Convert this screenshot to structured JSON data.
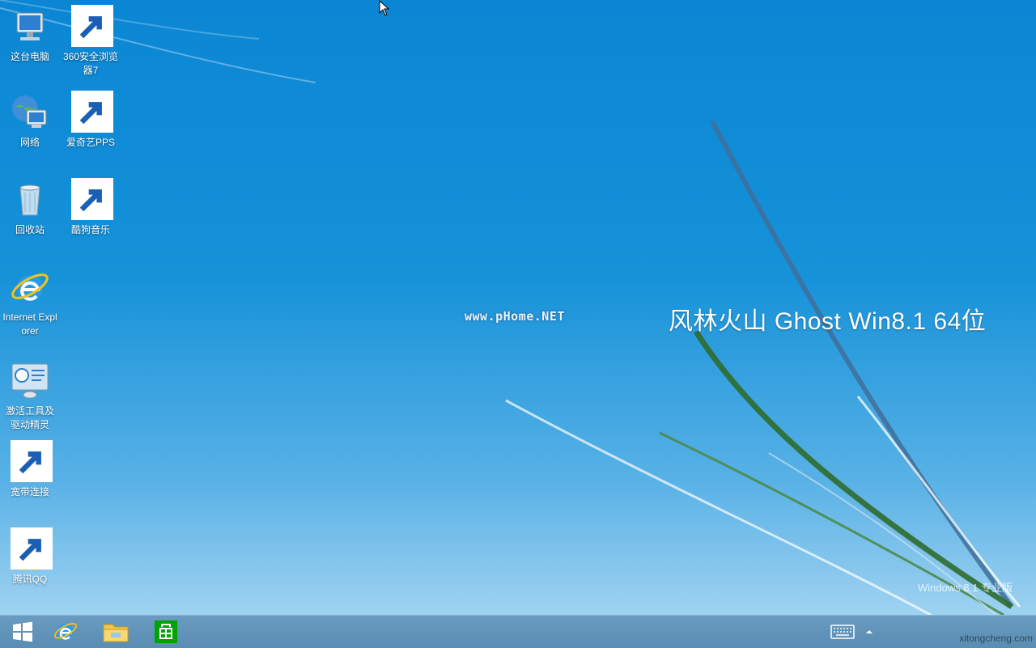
{
  "desktop": {
    "icons": [
      {
        "id": "this-pc",
        "label": "这台电脑"
      },
      {
        "id": "360-browser",
        "label": "360安全浏览器7"
      },
      {
        "id": "network",
        "label": "网络"
      },
      {
        "id": "iqiyi",
        "label": "爱奇艺PPS"
      },
      {
        "id": "recycle-bin",
        "label": "回收站"
      },
      {
        "id": "kugou",
        "label": "酷狗音乐"
      },
      {
        "id": "internet-explorer",
        "label": "Internet Explorer"
      },
      {
        "id": "activation-tools",
        "label": "激活工具及驱动精灵"
      },
      {
        "id": "broadband",
        "label": "宽带连接"
      },
      {
        "id": "tencent-qq",
        "label": "腾讯QQ"
      }
    ]
  },
  "wallpaper": {
    "brand_text": "风林火山 Ghost Win8.1 64位",
    "watermark": "www.pHome.NET",
    "version_text": "Windows 8.1 专业版",
    "site_text": "xitongcheng.com"
  },
  "taskbar": {
    "buttons": [
      {
        "name": "start",
        "icon": "windows-logo-icon"
      },
      {
        "name": "internet-explorer",
        "icon": "ie-icon"
      },
      {
        "name": "file-explorer",
        "icon": "folder-icon"
      },
      {
        "name": "store",
        "icon": "store-icon"
      }
    ],
    "tray": {
      "keyboard_icon": "keyboard-icon",
      "expand_icon": "chevron-up-icon"
    }
  },
  "colors": {
    "wallpaper_top": "#0a86d4",
    "wallpaper_bottom": "#9fd2f1",
    "taskbar": "#5a8db4"
  }
}
